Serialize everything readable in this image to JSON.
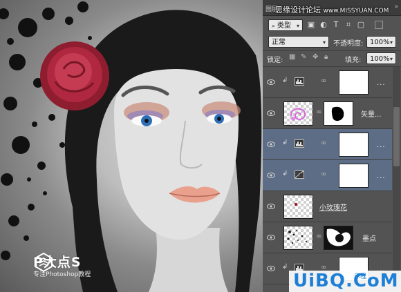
{
  "watermark": {
    "top": "思缘设计论坛",
    "top_url": "www.MISSYUAN.COM",
    "bottom": "UiBQ.CoM",
    "bottom_suffix": "示程"
  },
  "logo": {
    "title": "P大点S",
    "subtitle": "专注Photoshop教程"
  },
  "panel": {
    "tab_label": "图层",
    "filter": {
      "value": "类型"
    },
    "filter_icons": [
      "image-filter-icon",
      "adjustment-filter-icon",
      "type-filter-icon",
      "shape-filter-icon",
      "smart-object-filter-icon",
      "toggle-filter-icon"
    ],
    "blend_mode": {
      "value": "正常"
    },
    "opacity": {
      "label": "不透明度:",
      "value": "100%"
    },
    "lock": {
      "label": "锁定:"
    },
    "fill": {
      "label": "填充:",
      "value": "100%"
    },
    "layers": [
      {
        "type": "levels-adjustment",
        "clipped": true,
        "name": "",
        "more": "...",
        "selected": false
      },
      {
        "type": "vector-smart",
        "clipped": false,
        "name": "矢量...",
        "more": "",
        "selected": false
      },
      {
        "type": "levels-adjustment",
        "clipped": true,
        "name": "",
        "more": "...",
        "selected": true
      },
      {
        "type": "curves-adjustment",
        "clipped": true,
        "name": "",
        "more": "...",
        "selected": true
      },
      {
        "type": "pixel",
        "clipped": false,
        "name": "小玫瑰花",
        "more": "",
        "selected": false
      },
      {
        "type": "pixel-mask",
        "clipped": false,
        "name": "墨点",
        "more": "",
        "selected": false
      },
      {
        "type": "levels-adjustment",
        "clipped": true,
        "name": "",
        "more": "...",
        "selected": false
      }
    ]
  },
  "colors": {
    "panel_bg": "#535353",
    "selected_row": "#5d6d86",
    "rose": "#b0283f",
    "watermark_blue": "#1e7fd6"
  }
}
